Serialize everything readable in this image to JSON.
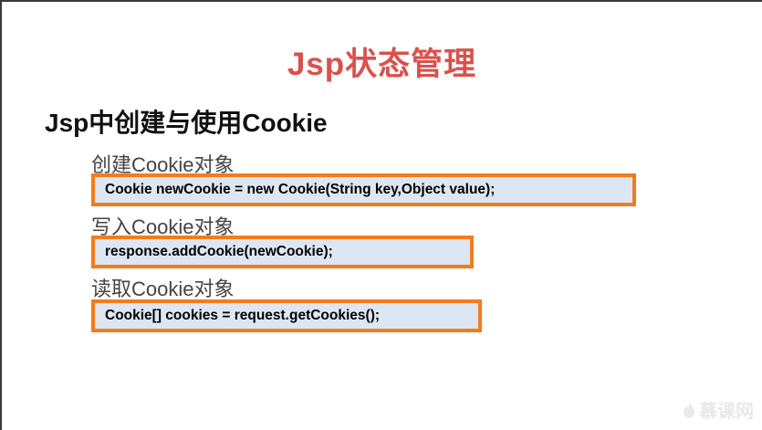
{
  "slide": {
    "title": "Jsp状态管理",
    "heading": "Jsp中创建与使用Cookie",
    "sections": [
      {
        "label": "创建Cookie对象",
        "code": "Cookie newCookie = new Cookie(String key,Object value);"
      },
      {
        "label": "写入Cookie对象",
        "code": "response.addCookie(newCookie);"
      },
      {
        "label": "读取Cookie对象",
        "code": "Cookie[] cookies = request.getCookies();"
      }
    ]
  },
  "watermark": {
    "text": "慕课网",
    "icon": "flame-icon"
  },
  "colors": {
    "title": "#d9514c",
    "code_border": "#f47c1c",
    "code_background": "#dde6f3"
  }
}
